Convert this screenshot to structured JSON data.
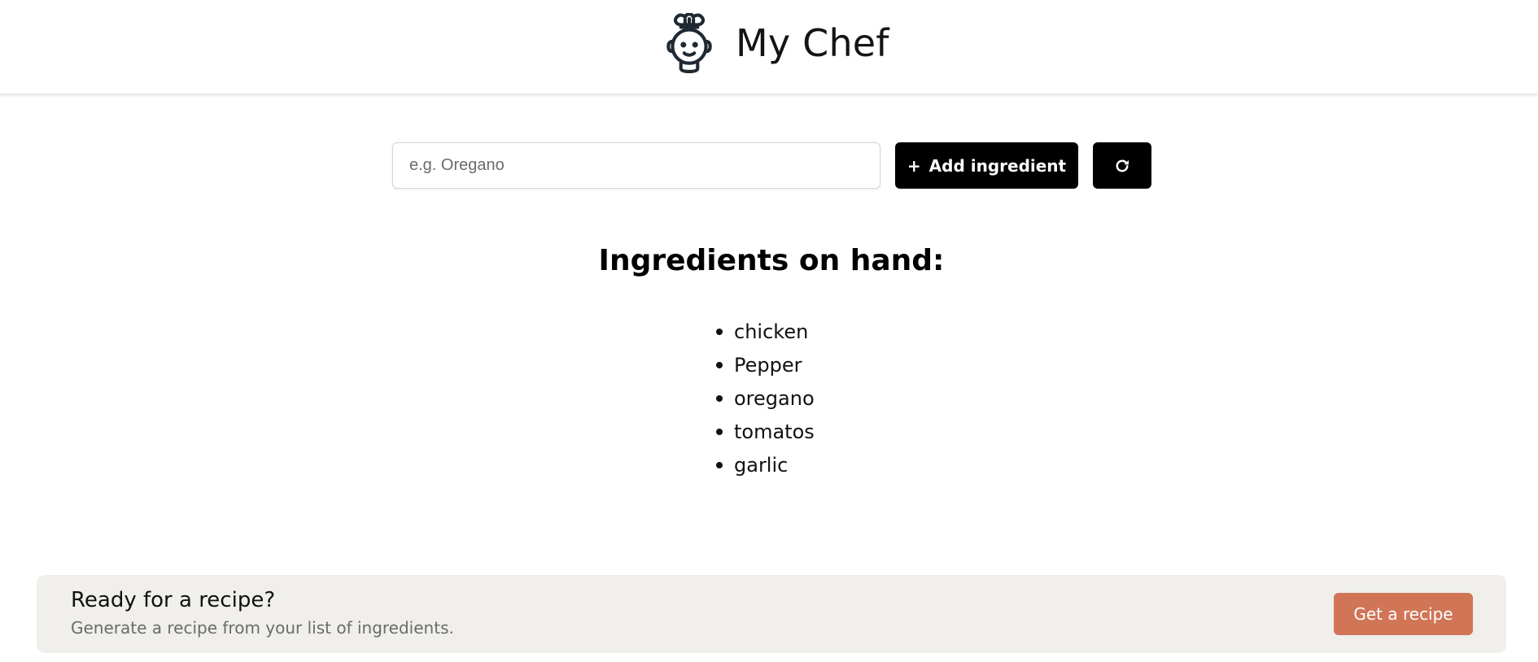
{
  "header": {
    "title": "My Chef",
    "logo_icon": "chef-robot-icon"
  },
  "add_form": {
    "input_value": "",
    "placeholder": "e.g. Oregano",
    "add_button_plus": "+",
    "add_button_label": "Add ingredient",
    "refresh_icon": "refresh-icon"
  },
  "ingredients": {
    "heading": "Ingredients on hand:",
    "items": [
      "chicken",
      "Pepper",
      "oregano",
      "tomatos",
      "garlic"
    ]
  },
  "cta": {
    "title": "Ready for a recipe?",
    "subtitle": "Generate a recipe from your list of ingredients.",
    "button_label": "Get a recipe"
  },
  "colors": {
    "primary_button": "#000000",
    "cta_button": "#d17557",
    "cta_panel": "#f0efeb"
  }
}
